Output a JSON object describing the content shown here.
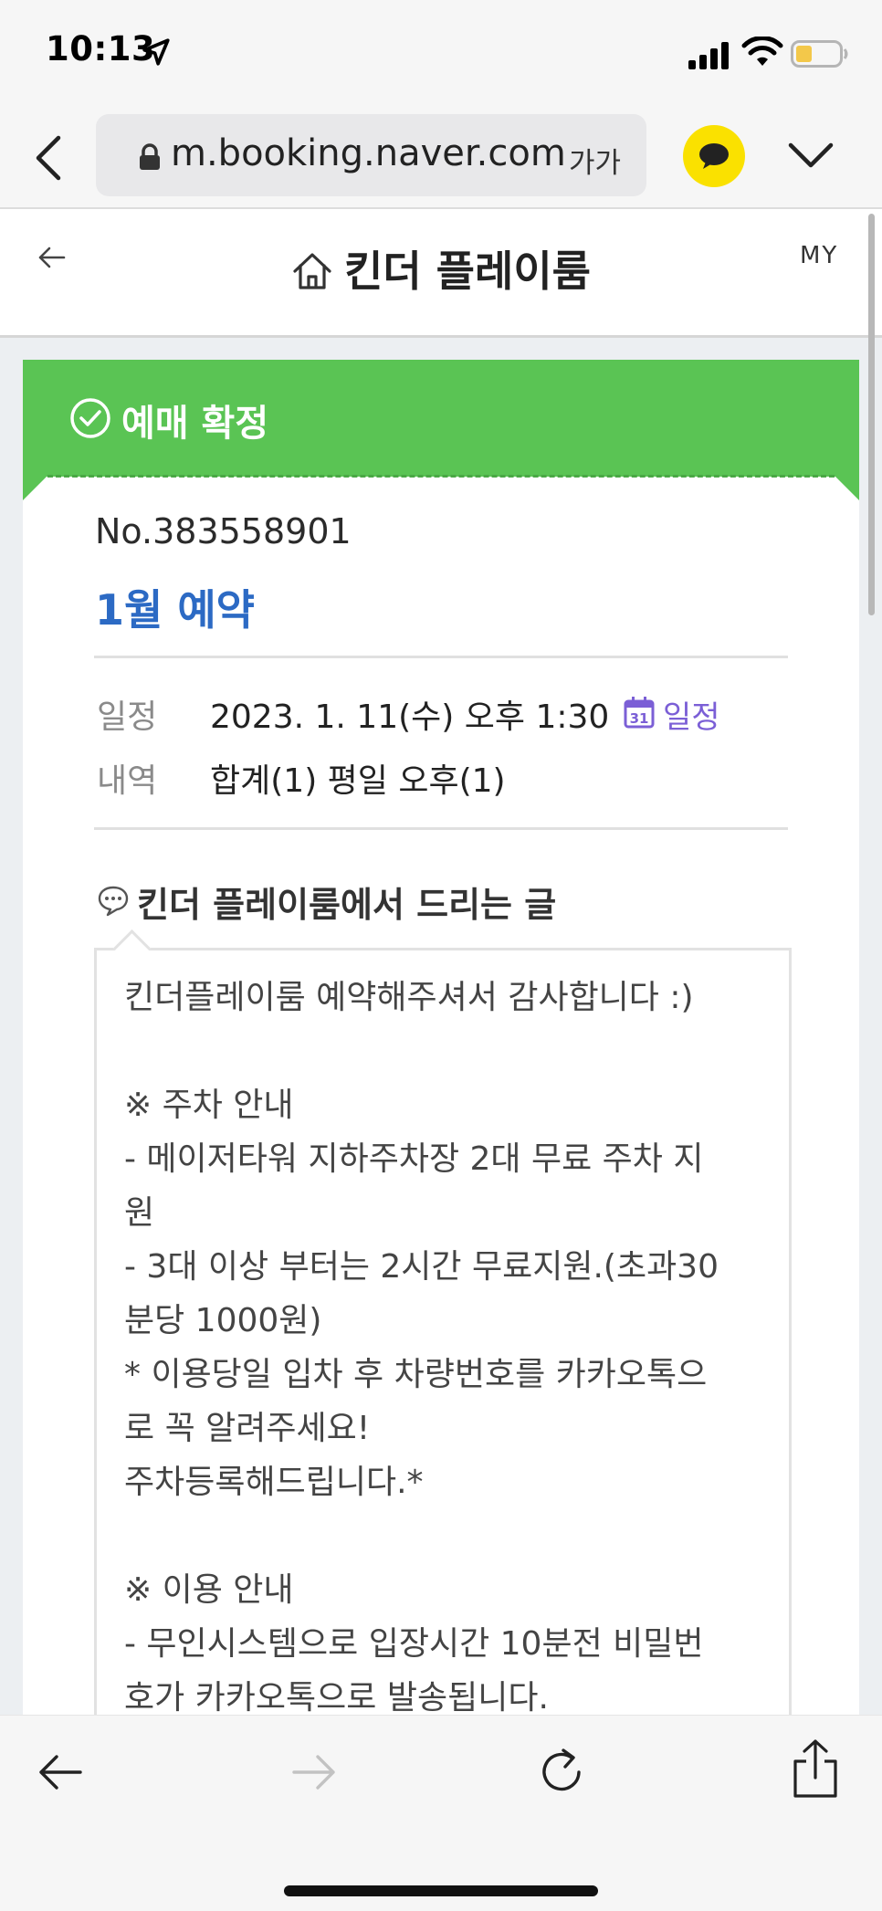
{
  "status_bar": {
    "time": "10:13"
  },
  "browser": {
    "url": "m.booking.naver.com",
    "text_size_label": "가가"
  },
  "page_header": {
    "title": "킨더 플레이룸",
    "my_label": "MY"
  },
  "booking": {
    "status": "예매 확정",
    "number": "No.383558901",
    "name": "1월 예약",
    "schedule_label": "일정",
    "schedule_value": "2023. 1. 11(수) 오후 1:30",
    "calendar_link": "일정",
    "calendar_icon_day": "31",
    "detail_label": "내역",
    "detail_value": "합계(1) 평일 오후(1)"
  },
  "message": {
    "heading": "킨더 플레이룸에서 드리는 글",
    "body": "킨더플레이룸 예약해주셔서 감사합니다 :)\n\n※ 주차 안내\n- 메이저타워 지하주차장 2대 무료 주차 지\n원\n- 3대 이상 부터는 2시간 무료지원.(초과30\n분당 1000원)\n* 이용당일 입차 후 차량번호를 카카오톡으\n로 꼭 알려주세요!\n주차등록해드립니다.*\n\n※ 이용 안내\n- 무인시스템으로 입장시간 10분전 비밀번\n호가 카카오톡으로 발송됩니다."
  },
  "colors": {
    "status_green": "#5ac454",
    "accent_blue": "#2c6ac4",
    "calendar_purple": "#7b5fd6",
    "kakao_yellow": "#fae100"
  },
  "icons": [
    "location-arrow-icon",
    "signal-icon",
    "wifi-icon",
    "battery-icon",
    "chevron-left-icon",
    "lock-icon",
    "kakao-chat-icon",
    "chevron-down-icon",
    "arrow-left-icon",
    "home-icon",
    "check-circle-icon",
    "calendar-icon",
    "speech-bubble-icon",
    "reload-icon",
    "share-icon",
    "arrow-right-icon"
  ]
}
